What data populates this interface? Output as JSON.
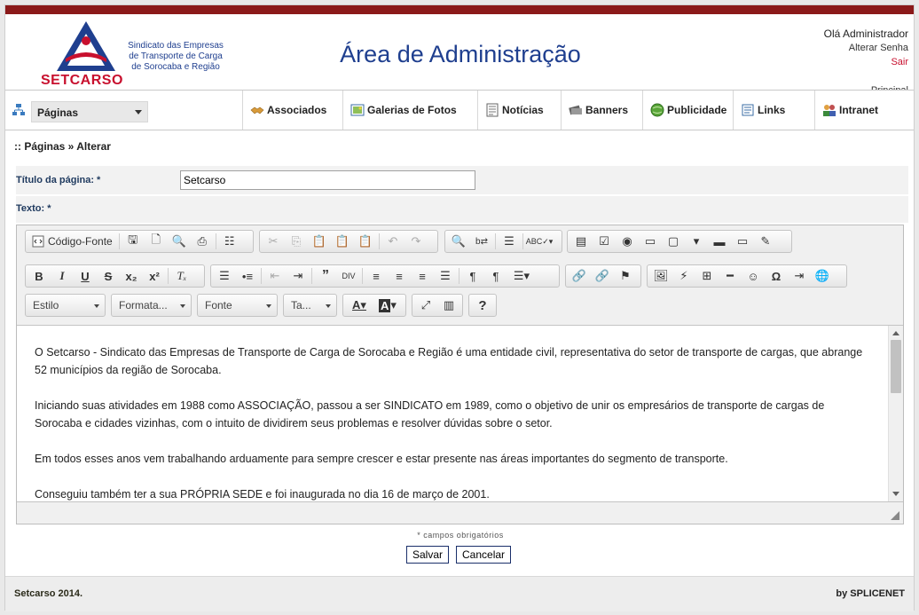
{
  "header": {
    "logo_name": "SETCARSO",
    "logo_tagline_1": "Sindicato das Empresas",
    "logo_tagline_2": "de Transporte de Carga",
    "logo_tagline_3": "de Sorocaba e Região",
    "title": "Área de Administração",
    "greeting": "Olá Administrador",
    "change_password": "Alterar Senha",
    "logout": "Sair",
    "home": "Principal"
  },
  "menu": {
    "pages_select": "Páginas",
    "items": [
      {
        "label": "Associados",
        "icon": "handshake-icon"
      },
      {
        "label": "Galerias de Fotos",
        "icon": "gallery-icon"
      },
      {
        "label": "Notícias",
        "icon": "news-icon"
      },
      {
        "label": "Banners",
        "icon": "banner-icon"
      },
      {
        "label": "Publicidade",
        "icon": "globe-icon"
      },
      {
        "label": "Links",
        "icon": "links-icon"
      },
      {
        "label": "Intranet",
        "icon": "users-icon"
      }
    ]
  },
  "breadcrumb": ":: Páginas » Alterar",
  "form": {
    "title_label": "Título da página: *",
    "title_value": "Setcarso",
    "text_label": "Texto: *",
    "required_note": "* campos obrigatórios",
    "save": "Salvar",
    "cancel": "Cancelar"
  },
  "editor": {
    "source_label": "Código-Fonte",
    "combos": [
      "Estilo",
      "Formata...",
      "Fonte",
      "Ta..."
    ],
    "paragraphs": [
      "O Setcarso - Sindicato das Empresas de Transporte de Carga de Sorocaba e Região é uma entidade civil, representativa do setor de transporte de cargas, que abrange 52 municípios da região de Sorocaba.",
      "Iniciando suas atividades em 1988 como ASSOCIAÇÃO, passou a ser SINDICATO em 1989, como o objetivo de unir os empresários de transporte de cargas de Sorocaba e cidades vizinhas, com o intuito de dividirem seus problemas e resolver dúvidas sobre o setor.",
      "Em todos esses anos vem trabalhando arduamente para sempre crescer e estar presente nas áreas importantes do segmento de transporte.",
      "Conseguiu também ter a sua PRÓPRIA SEDE e foi inaugurada no dia 16 de março de 2001."
    ]
  },
  "footer": {
    "left": "Setcarso 2014.",
    "right": "by SPLICENET"
  },
  "colors": {
    "brand_red": "#c8102e",
    "brand_blue": "#1f3f8f",
    "top_bar": "#8b1a1a"
  }
}
